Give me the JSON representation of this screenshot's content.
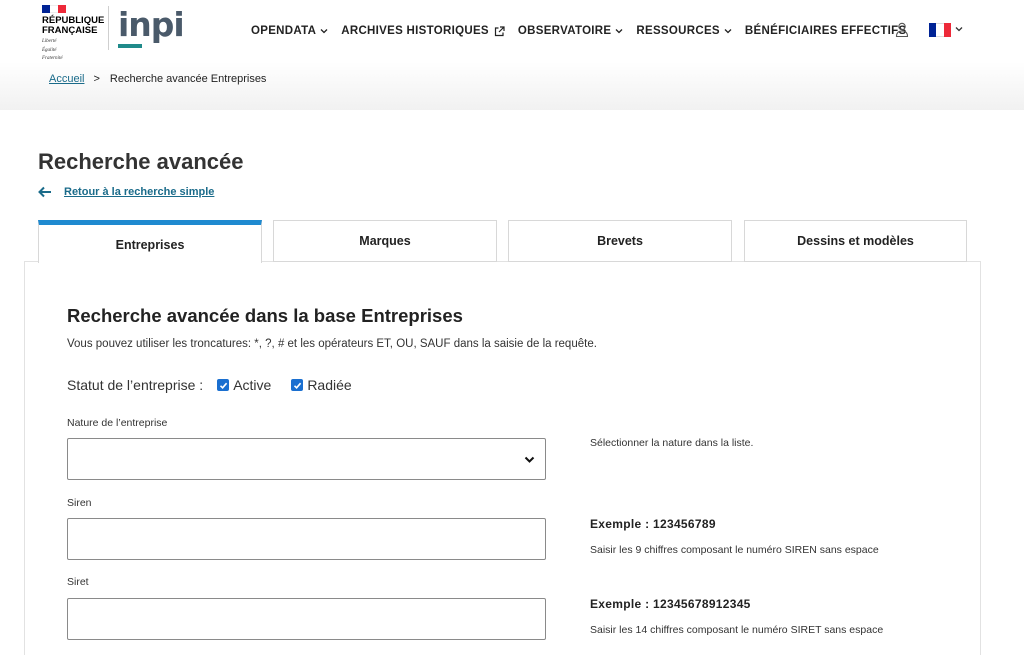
{
  "header": {
    "republique_lines": [
      "RÉPUBLIQUE",
      "FRANÇAISE"
    ],
    "motto_lines": [
      "Liberté",
      "Égalité",
      "Fraternité"
    ],
    "logo_text": "inpi",
    "nav": [
      {
        "label": "OPENDATA",
        "icon": "chevron-down-icon"
      },
      {
        "label": "ARCHIVES HISTORIQUES",
        "icon": "external-link-icon"
      },
      {
        "label": "OBSERVATOIRE",
        "icon": "chevron-down-icon"
      },
      {
        "label": "RESSOURCES",
        "icon": "chevron-down-icon"
      },
      {
        "label": "BÉNÉFICIAIRES EFFECTIFS",
        "icon": ""
      }
    ],
    "account_icon": "user-icon",
    "language_icon": "french-flag-icon",
    "colors": {
      "blue": "#002395",
      "white": "#ffffff",
      "red": "#ed2939",
      "logo_accent": "#1f8a8a"
    }
  },
  "breadcrumb": {
    "home": "Accueil",
    "separator": ">",
    "current": "Recherche avancée Entreprises"
  },
  "main": {
    "title": "Recherche avancée",
    "back_link": "Retour à la recherche simple",
    "tabs": [
      {
        "label": "Entreprises",
        "active": true
      },
      {
        "label": "Marques",
        "active": false
      },
      {
        "label": "Brevets",
        "active": false
      },
      {
        "label": "Dessins et modèles",
        "active": false
      }
    ],
    "accent_color": "#1f8ad0"
  },
  "form": {
    "heading": "Recherche avancée dans la base Entreprises",
    "intro": "Vous pouvez utiliser les troncatures: *, ?, # et les opérateurs ET, OU, SAUF dans la saisie de la requête.",
    "statut_label": "Statut de l’entreprise :",
    "checkboxes": [
      {
        "label": "Active",
        "checked": true
      },
      {
        "label": "Radiée",
        "checked": true
      }
    ],
    "nature": {
      "label": "Nature de l’entreprise",
      "value": "",
      "help": "Sélectionner la nature dans la liste."
    },
    "siren": {
      "label": "Siren",
      "value": "",
      "example": "Exemple : 123456789",
      "help": "Saisir les 9 chiffres composant le numéro SIREN sans espace"
    },
    "siret": {
      "label": "Siret",
      "value": "",
      "example": "Exemple : 12345678912345",
      "help": "Saisir les 14 chiffres composant le numéro SIRET sans espace"
    }
  }
}
